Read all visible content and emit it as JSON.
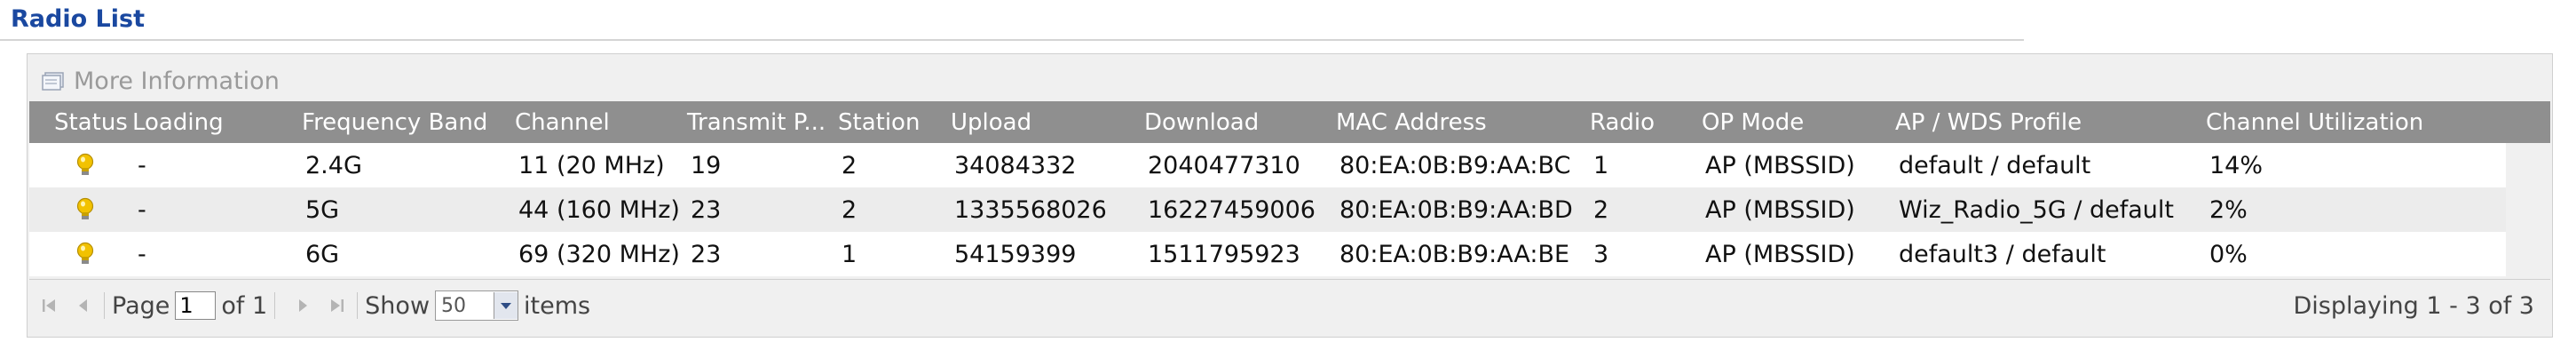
{
  "section": {
    "title": "Radio List"
  },
  "panel": {
    "more_info_label": "More Information"
  },
  "columns": [
    "Status",
    "Loading",
    "Frequency Band",
    "Channel",
    "Transmit P...",
    "Station",
    "Upload",
    "Download",
    "MAC Address",
    "Radio",
    "OP Mode",
    "AP / WDS Profile",
    "Channel Utilization"
  ],
  "rows": [
    {
      "status_icon": "lightbulb-icon",
      "loading": "-",
      "frequency_band": "2.4G",
      "channel": "11 (20 MHz)",
      "transmit_power": "19",
      "station": "2",
      "upload": "34084332",
      "download": "2040477310",
      "mac": "80:EA:0B:B9:AA:BC",
      "radio": "1",
      "op_mode": "AP (MBSSID)",
      "profile": "default / default",
      "utilization": "14%"
    },
    {
      "status_icon": "lightbulb-icon",
      "loading": "-",
      "frequency_band": "5G",
      "channel": "44 (160 MHz)",
      "transmit_power": "23",
      "station": "2",
      "upload": "1335568026",
      "download": "16227459006",
      "mac": "80:EA:0B:B9:AA:BD",
      "radio": "2",
      "op_mode": "AP (MBSSID)",
      "profile": "Wiz_Radio_5G / default",
      "utilization": "2%"
    },
    {
      "status_icon": "lightbulb-icon",
      "loading": "-",
      "frequency_band": "6G",
      "channel": "69 (320 MHz)",
      "transmit_power": "23",
      "station": "1",
      "upload": "54159399",
      "download": "1511795923",
      "mac": "80:EA:0B:B9:AA:BE",
      "radio": "3",
      "op_mode": "AP (MBSSID)",
      "profile": "default3 / default",
      "utilization": "0%"
    }
  ],
  "pager": {
    "page_label": "Page",
    "page_value": "1",
    "of_label": "of 1",
    "show_label": "Show",
    "show_value": "50",
    "items_label": "items",
    "displaying": "Displaying 1 - 3 of 3"
  },
  "colors": {
    "header_bg": "#8f8f8f",
    "title": "#1a48a0",
    "bulb": "#f2c200"
  }
}
